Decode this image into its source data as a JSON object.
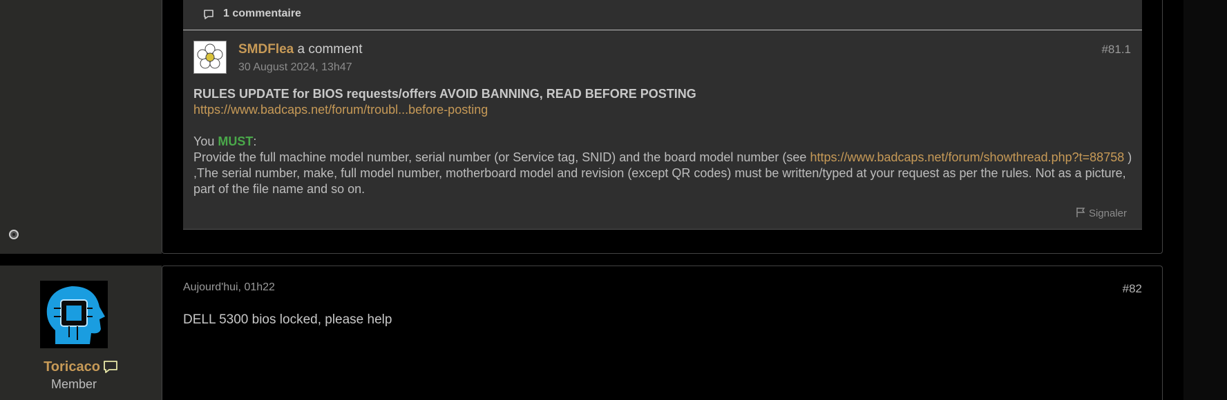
{
  "comments_bar": {
    "count_label": "1 commentaire"
  },
  "comment": {
    "username": "SMDFlea",
    "verb": "a comment",
    "date": "30 August 2024, 13h47",
    "number": "#81.1",
    "rules_heading": "RULES UPDATE for BIOS requests/offers AVOID BANNING, READ BEFORE POSTING",
    "rules_link": "https://www.badcaps.net/forum/troubl...before-posting",
    "you": "You ",
    "must": "MUST",
    "colon": ":",
    "provide_text": "Provide the full machine model number, serial number (or Service tag, SNID) and the board model number (see ",
    "thread_link": "https://www.badcaps.net/forum/showthread.php?t=88758",
    "rest_text": " ) ,The serial number, make, full model number, motherboard model and revision (except QR codes) must be written/typed at your request as per the rules. Not as a picture, part of the file name and so on.",
    "report_label": "Signaler"
  },
  "post": {
    "username": "Toricaco",
    "role": "Member",
    "date": "Aujourd'hui, 01h22",
    "number": "#82",
    "body": "DELL 5300 bios locked, please help"
  },
  "colors": {
    "accent": "#c79a57",
    "must": "#4aa84a",
    "panel": "#2f2f2f",
    "sidebar": "#2a2a28"
  },
  "icons": [
    "comment-icon",
    "flag-icon",
    "chat-bubble-icon",
    "presence-icon"
  ]
}
